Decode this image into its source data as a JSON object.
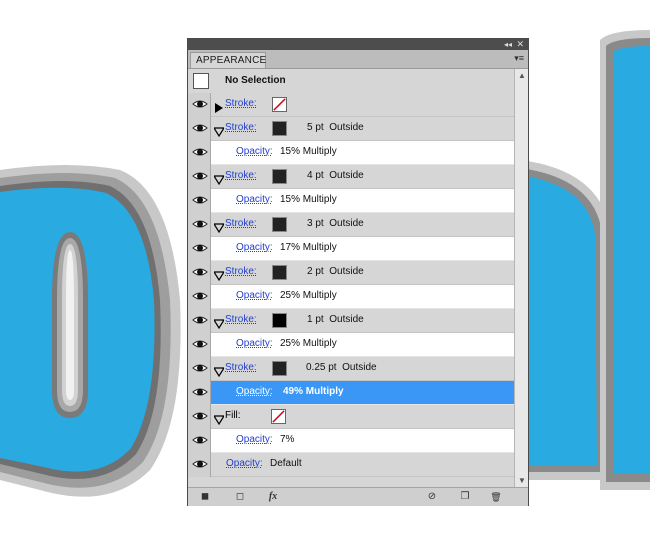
{
  "panel": {
    "tab_label": "APPEARANCE",
    "collapse_glyph": "◂◂",
    "close_glyph": "✕",
    "menu_glyph": "▾≡",
    "header_title": "No Selection"
  },
  "rows": [
    {
      "kind": "stroke",
      "expanded": false,
      "label": "Stroke:",
      "swatch": "none",
      "value": ""
    },
    {
      "kind": "stroke",
      "expanded": true,
      "label": "Stroke:",
      "swatch": "dark",
      "value": "5 pt  Outside"
    },
    {
      "kind": "opacity",
      "label": "Opacity:",
      "value": "15% Multiply"
    },
    {
      "kind": "stroke",
      "expanded": true,
      "label": "Stroke:",
      "swatch": "dark",
      "value": "4 pt  Outside"
    },
    {
      "kind": "opacity",
      "label": "Opacity:",
      "value": "15% Multiply"
    },
    {
      "kind": "stroke",
      "expanded": true,
      "label": "Stroke:",
      "swatch": "dark",
      "value": "3 pt  Outside"
    },
    {
      "kind": "opacity",
      "label": "Opacity:",
      "value": "17% Multiply"
    },
    {
      "kind": "stroke",
      "expanded": true,
      "label": "Stroke:",
      "swatch": "dark",
      "value": "2 pt  Outside"
    },
    {
      "kind": "opacity",
      "label": "Opacity:",
      "value": "25% Multiply"
    },
    {
      "kind": "stroke",
      "expanded": true,
      "label": "Stroke:",
      "swatch": "black",
      "value": "1 pt  Outside"
    },
    {
      "kind": "opacity",
      "label": "Opacity:",
      "value": "25% Multiply"
    },
    {
      "kind": "stroke",
      "expanded": true,
      "label": "Stroke:",
      "swatch": "dark",
      "value": "0.25 pt  Outside"
    },
    {
      "kind": "opacity",
      "label": "Opacity:",
      "value": "49% Multiply",
      "selected": true
    },
    {
      "kind": "fill",
      "expanded": true,
      "label": "Fill:",
      "swatch": "none",
      "value": ""
    },
    {
      "kind": "opacity",
      "label": "Opacity:",
      "value": "7%"
    },
    {
      "kind": "opacity-root",
      "label": "Opacity:",
      "value": "Default"
    }
  ],
  "bottom": {
    "new_art_glyph": "◼",
    "new_layer_glyph": "◻",
    "fx_label": "fx",
    "clear_glyph": "⊘",
    "duplicate_glyph": "❐",
    "trash_glyph": "🗑"
  },
  "colors": {
    "artwork_blue": "#29abe2",
    "selection_blue": "#3b97f5",
    "link_blue": "#1f3fd0"
  }
}
